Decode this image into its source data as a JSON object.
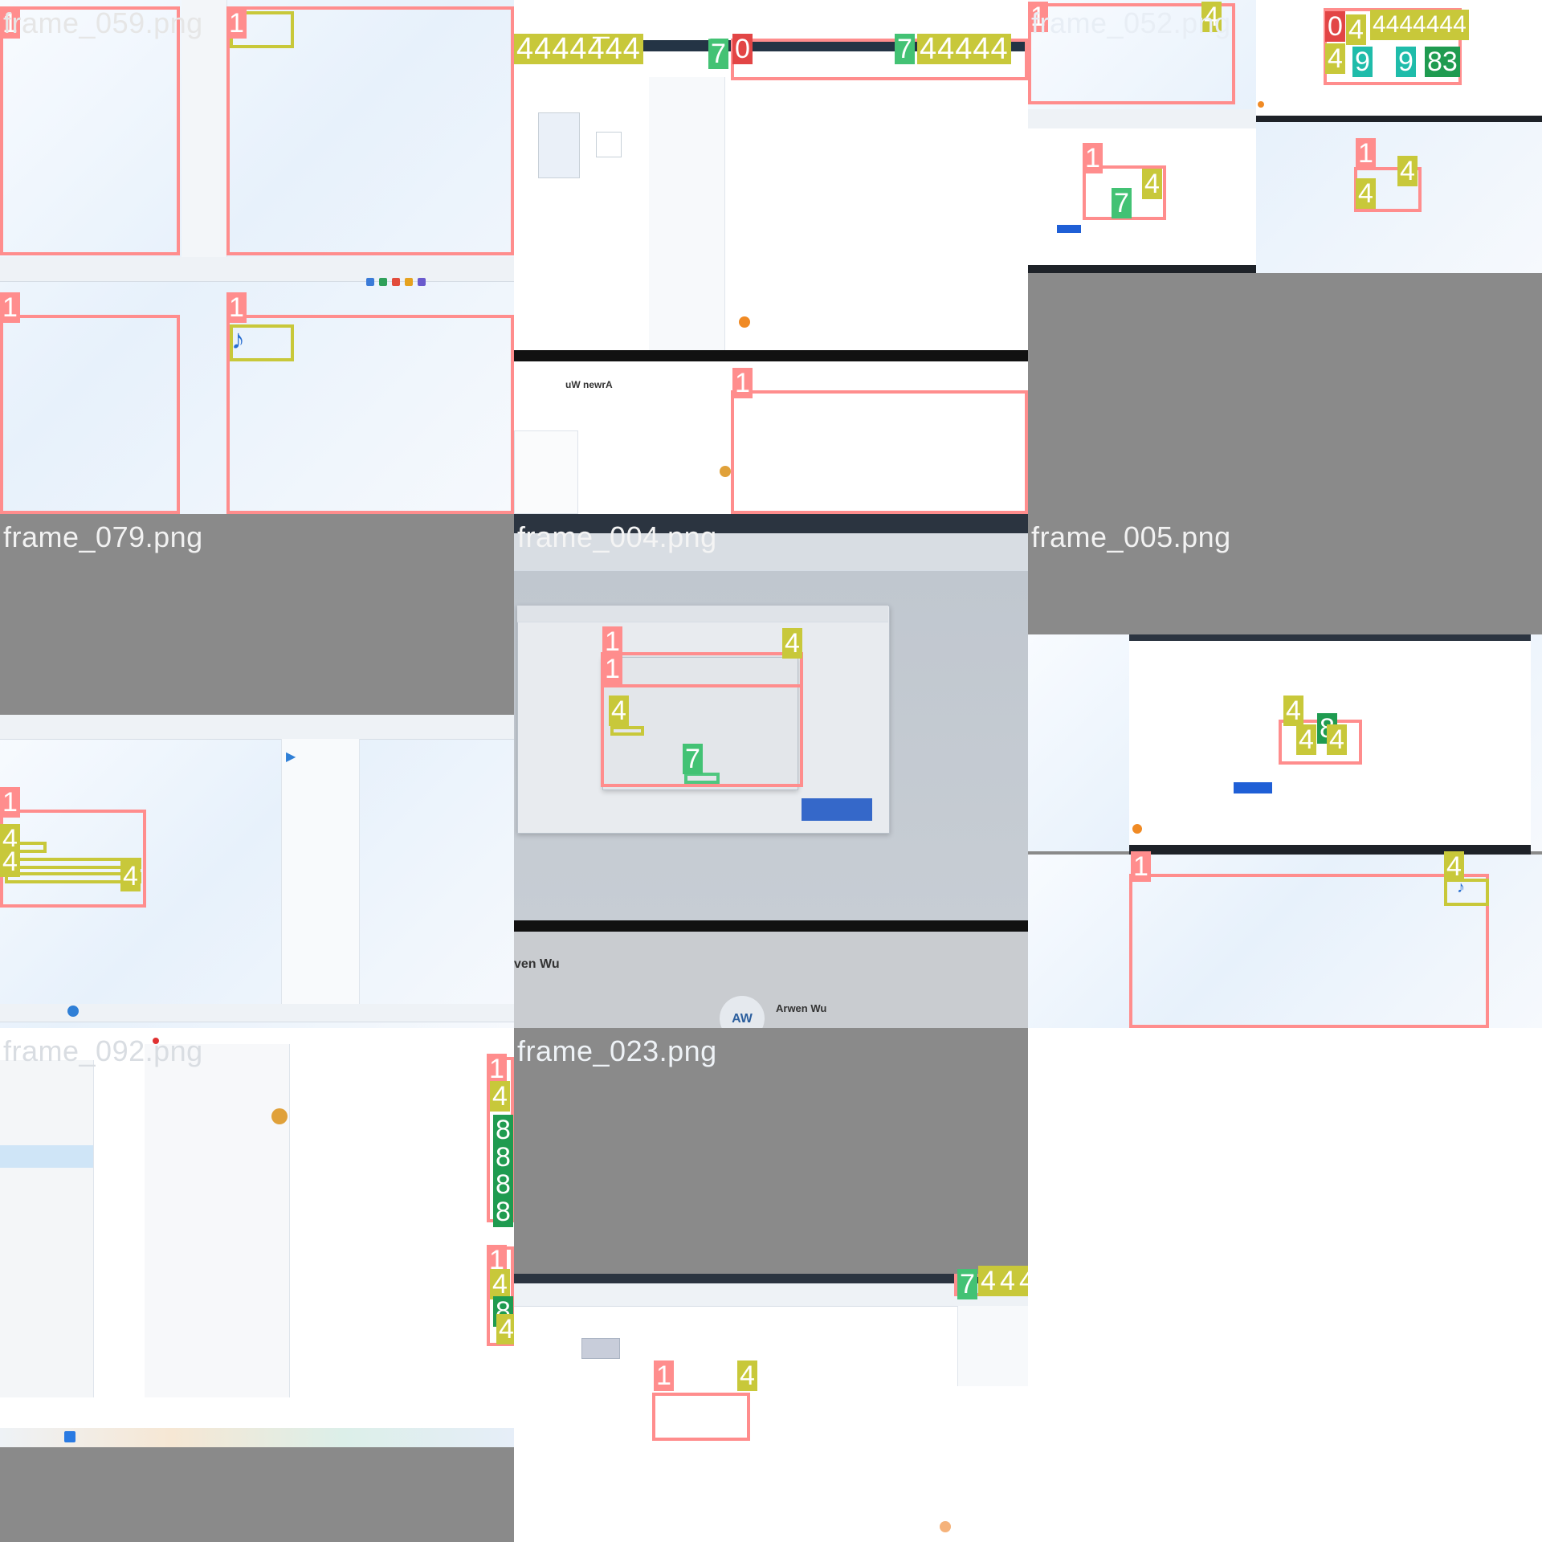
{
  "frames": [
    {
      "caption": "frame_059.png"
    },
    {
      "caption": "frame_018.png"
    },
    {
      "caption": "frame_052.png"
    },
    {
      "caption": "frame_079.png"
    },
    {
      "caption": "frame_004.png"
    },
    {
      "caption": "frame_005.png"
    },
    {
      "caption": "frame_092.png"
    },
    {
      "caption": "frame_023.png"
    }
  ],
  "labels": {
    "one": "1",
    "zero": "0",
    "four": "4",
    "seven": "7",
    "eight": "8",
    "nine": "9",
    "eighty_three": "83",
    "four_row": "4444444",
    "four_run": "44444"
  },
  "texts": {
    "user_name_mirrored": "uW newrA",
    "user_name": "Arwen Wu",
    "user_name_cropped": "ven Wu",
    "avatar_initials": "AW"
  },
  "colors": {
    "label_1": "#ff8d8d",
    "label_0": "#e24545",
    "label_4": "#c8c83a",
    "label_7": "#43c274",
    "label_8": "#1f9b50",
    "label_9": "#1fbcaa",
    "empty_tile": "#8a8a8a"
  }
}
